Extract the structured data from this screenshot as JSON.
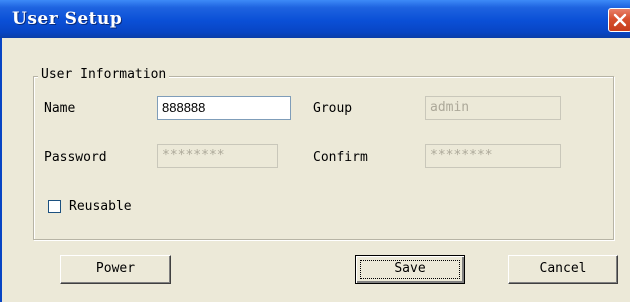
{
  "window": {
    "title": "User Setup"
  },
  "group": {
    "legend": "User Information"
  },
  "fields": {
    "name": {
      "label": "Name",
      "value": "888888"
    },
    "group": {
      "label": "Group",
      "value": "admin"
    },
    "password": {
      "label": "Password",
      "value": "********"
    },
    "confirm": {
      "label": "Confirm",
      "value": "********"
    }
  },
  "reusable": {
    "label": "Reusable",
    "checked": false
  },
  "buttons": {
    "power": "Power",
    "save": "Save",
    "cancel": "Cancel"
  },
  "colors": {
    "titlebar": "#0a4fd6",
    "close": "#d7502e",
    "dialog_bg": "#ece9d8"
  },
  "icons": {
    "close": "close-x-icon"
  }
}
